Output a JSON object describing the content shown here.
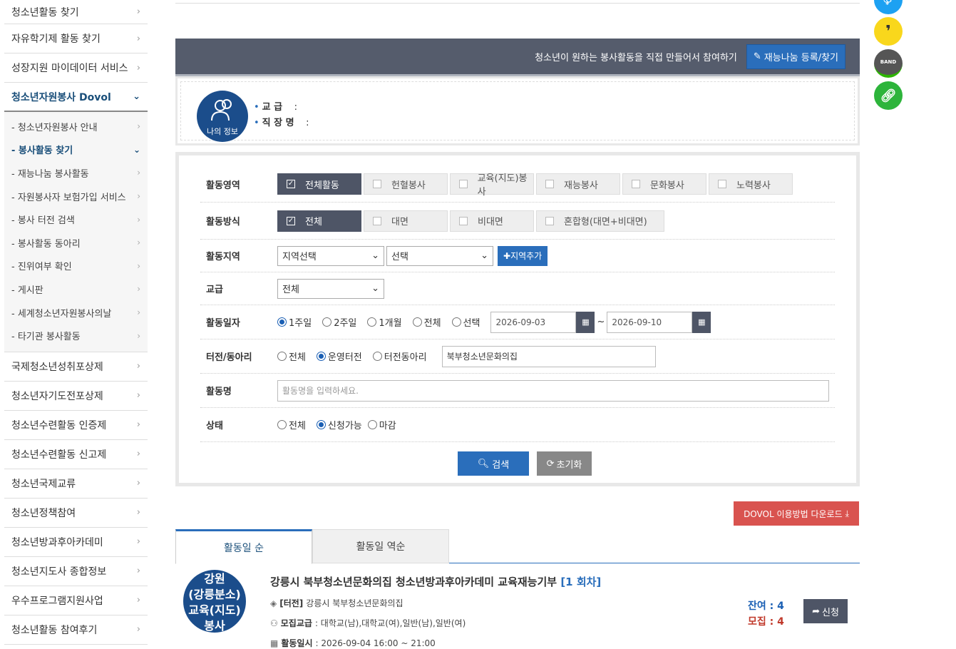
{
  "sidebar": {
    "top_items": [
      "청소년활동 찾기",
      "자유학기제 활동 찾기",
      "성장지원 마이데이터 서비스"
    ],
    "active_item": "청소년자원봉사 Dovol",
    "sub_items": [
      "청소년자원봉사 안내",
      "봉사활동 찾기",
      "재능나눔 봉사활동",
      "자원봉사자 보험가입 서비스",
      "봉사 터전 검색",
      "봉사활동 동아리",
      "진위여부 확인",
      "게시판",
      "세계청소년자원봉사의날",
      "타기관 봉사활동"
    ],
    "active_sub": "봉사활동 찾기",
    "bottom_items": [
      "국제청소년성취포상제",
      "청소년자기도전포상제",
      "청소년수련활동 인증제",
      "청소년수련활동 신고제",
      "청소년국제교류",
      "청소년정책참여",
      "청소년방과후아카데미",
      "청소년지도사 종합정보",
      "우수프로그램지원사업",
      "청소년활동 참여후기"
    ]
  },
  "banner": {
    "text": "청소년이 원하는 봉사활동을 직접 만들어서 참여하기",
    "button": "재능나눔 등록/찾기"
  },
  "myinfo": {
    "avatar_label": "나의 정보",
    "grade_label": "교  급",
    "grade_value": ":",
    "job_label": "직 장 명",
    "job_value": ":"
  },
  "search": {
    "area_label": "활동영역",
    "area_options": [
      "전체활동",
      "헌혈봉사",
      "교육(지도)봉사",
      "재능봉사",
      "문화봉사",
      "노력봉사"
    ],
    "method_label": "활동방식",
    "method_options": [
      "전체",
      "대면",
      "비대면",
      "혼합형(대면+비대면)"
    ],
    "region_label": "활동지역",
    "region_select1": "지역선택",
    "region_select2": "선택",
    "region_add": "지역추가",
    "grade_label": "교급",
    "grade_select": "전체",
    "date_label": "활동일자",
    "date_options": [
      "1주일",
      "2주일",
      "1개월",
      "전체",
      "선택"
    ],
    "date_from": "2026-09-03",
    "date_tilde": "~",
    "date_to": "2026-09-10",
    "base_label": "터전/동아리",
    "base_options": [
      "전체",
      "운영터전",
      "터전동아리"
    ],
    "base_value": "북부청소년문화의집",
    "name_label": "활동명",
    "name_placeholder": "활동명을 입력하세요.",
    "status_label": "상태",
    "status_options": [
      "전체",
      "신청가능",
      "마감"
    ],
    "search_btn": "검색",
    "reset_btn": "초기화"
  },
  "download_btn": "DOVOL 이용방법 다운로드",
  "tabs": [
    "활동일 순",
    "활동일 역순"
  ],
  "result": {
    "badge_lines": [
      "강원",
      "(강릉분소)",
      "교육(지도)",
      "봉사"
    ],
    "title": "강릉시 북부청소년문화의집 청소년방과후아카데미 교육재능기부",
    "count": "[1 회차]",
    "base_label": "[터전]",
    "base_value": "강릉시 북부청소년문화의집",
    "recruit_label": "모집교급",
    "recruit_value": ": 대학교(남),대학교(여),일반(남),일반(여)",
    "date_label": "활동일시",
    "date_value": ": 2026-09-04   16:00 ~ 21:00",
    "remain": "잔여 : 4",
    "recruit": "모집 : 4",
    "apply": "신청"
  },
  "colors": {
    "primary": "#2a6ebb",
    "dark": "#4e5566",
    "red": "#d9534f",
    "navy": "#1b4d8b"
  }
}
